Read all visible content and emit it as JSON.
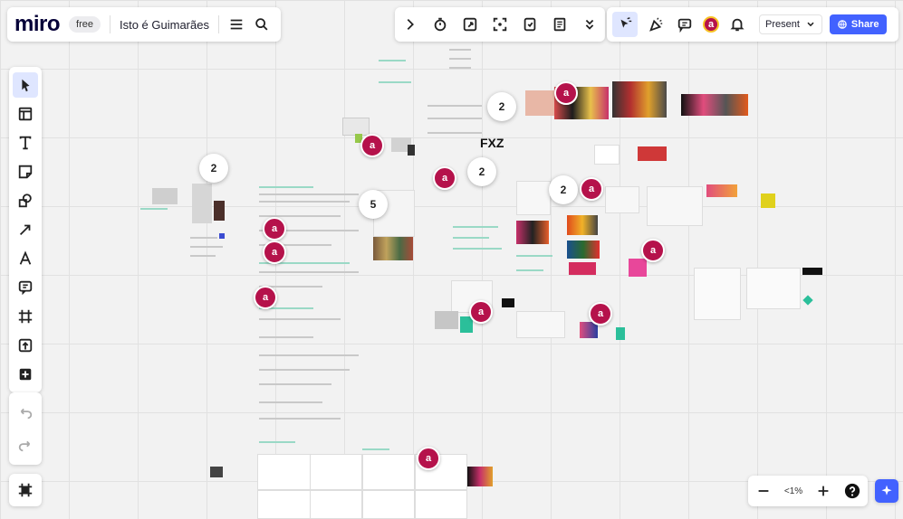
{
  "header": {
    "logo": "miro",
    "plan_badge": "free",
    "board_name": "Isto é Guimarães"
  },
  "topbar": {
    "user_initial": "a",
    "present_label": "Present",
    "share_label": "Share"
  },
  "left_toolbar": {
    "tools": [
      "select-tool",
      "templates-tool",
      "text-tool",
      "sticky-note-tool",
      "shapes-tool",
      "connector-tool",
      "pen-tool",
      "comment-tool",
      "frame-tool",
      "upload-tool",
      "more-apps-tool"
    ]
  },
  "zoom": {
    "level": "<1%"
  },
  "canvas": {
    "cursor_initial": "a",
    "clusters": [
      "2",
      "2",
      "2",
      "2",
      "5"
    ],
    "brand_mark": "FXZ"
  },
  "colors": {
    "accent": "#4262ff",
    "cursor": "#b5124b",
    "teal": "#2bbf9a"
  }
}
